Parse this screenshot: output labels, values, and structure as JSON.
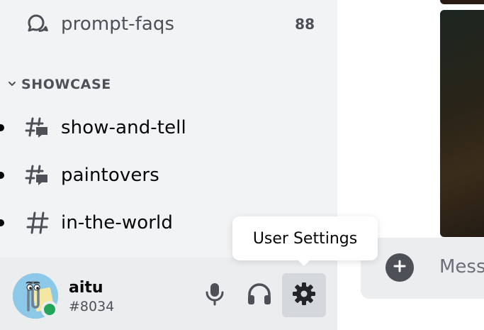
{
  "sidebar": {
    "channels_top": [
      {
        "label": "prompt-faqs",
        "count": "88",
        "icon": "forum-icon"
      }
    ],
    "category": {
      "label": "SHOWCASE",
      "icon": "chevron-down-icon"
    },
    "channels": [
      {
        "label": "show-and-tell",
        "icon": "thread-channel-icon",
        "unread": true
      },
      {
        "label": "paintovers",
        "icon": "thread-channel-icon",
        "unread": true
      },
      {
        "label": "in-the-world",
        "icon": "hash-icon",
        "unread": true
      }
    ]
  },
  "user_panel": {
    "username": "aitu",
    "discriminator": "#8034",
    "status": "online",
    "status_color": "#23a55a",
    "buttons": [
      {
        "name": "mute-button",
        "icon": "microphone-icon"
      },
      {
        "name": "deafen-button",
        "icon": "headphones-icon"
      },
      {
        "name": "user-settings-button",
        "icon": "gear-icon",
        "active": true
      }
    ]
  },
  "tooltip": {
    "text": "User Settings"
  },
  "composer": {
    "placeholder": "Mess"
  },
  "colors": {
    "sidebar_bg": "#f2f3f5",
    "user_panel_bg": "#ebedef",
    "text_primary": "#060607",
    "text_muted": "#4e5058"
  }
}
